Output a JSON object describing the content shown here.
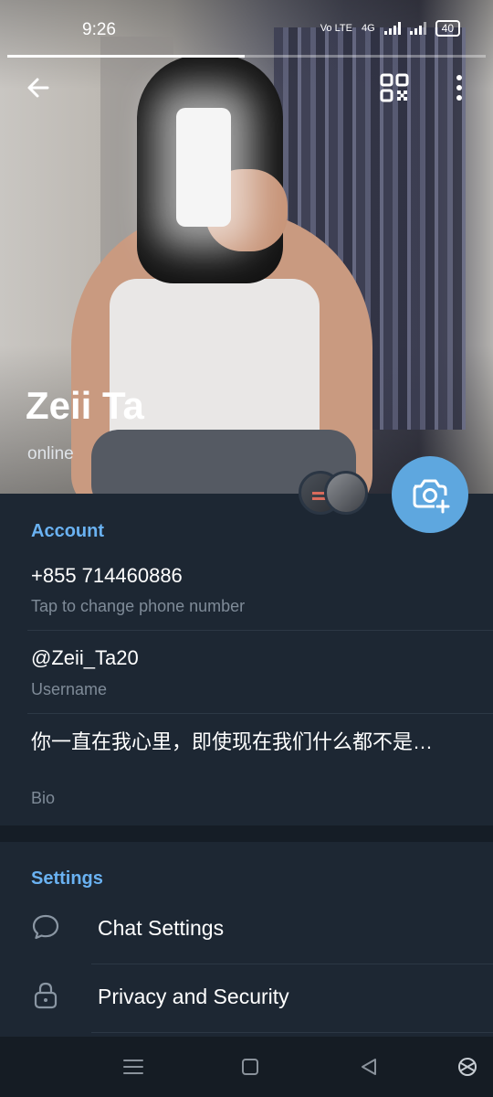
{
  "status_bar": {
    "time": "9:26",
    "network_label": "Vo LTE",
    "signal_label": "4G",
    "battery": "40"
  },
  "profile": {
    "name": "Zeii Ta",
    "status": "online"
  },
  "account": {
    "title": "Account",
    "phone": "+855 714460886",
    "phone_hint": "Tap to change phone number",
    "username": "@Zeii_Ta20",
    "username_label": "Username",
    "bio": "你一直在我心里，即使现在我们什么都不是…",
    "bio_label": "Bio"
  },
  "settings": {
    "title": "Settings",
    "items": [
      {
        "label": "Chat Settings",
        "icon": "chat-bubble-icon"
      },
      {
        "label": "Privacy and Security",
        "icon": "lock-icon"
      }
    ]
  },
  "colors": {
    "background": "#1d2733",
    "accent": "#6ab2f2",
    "camera_button": "#5ea7df",
    "secondary_text": "#7f8b98"
  }
}
